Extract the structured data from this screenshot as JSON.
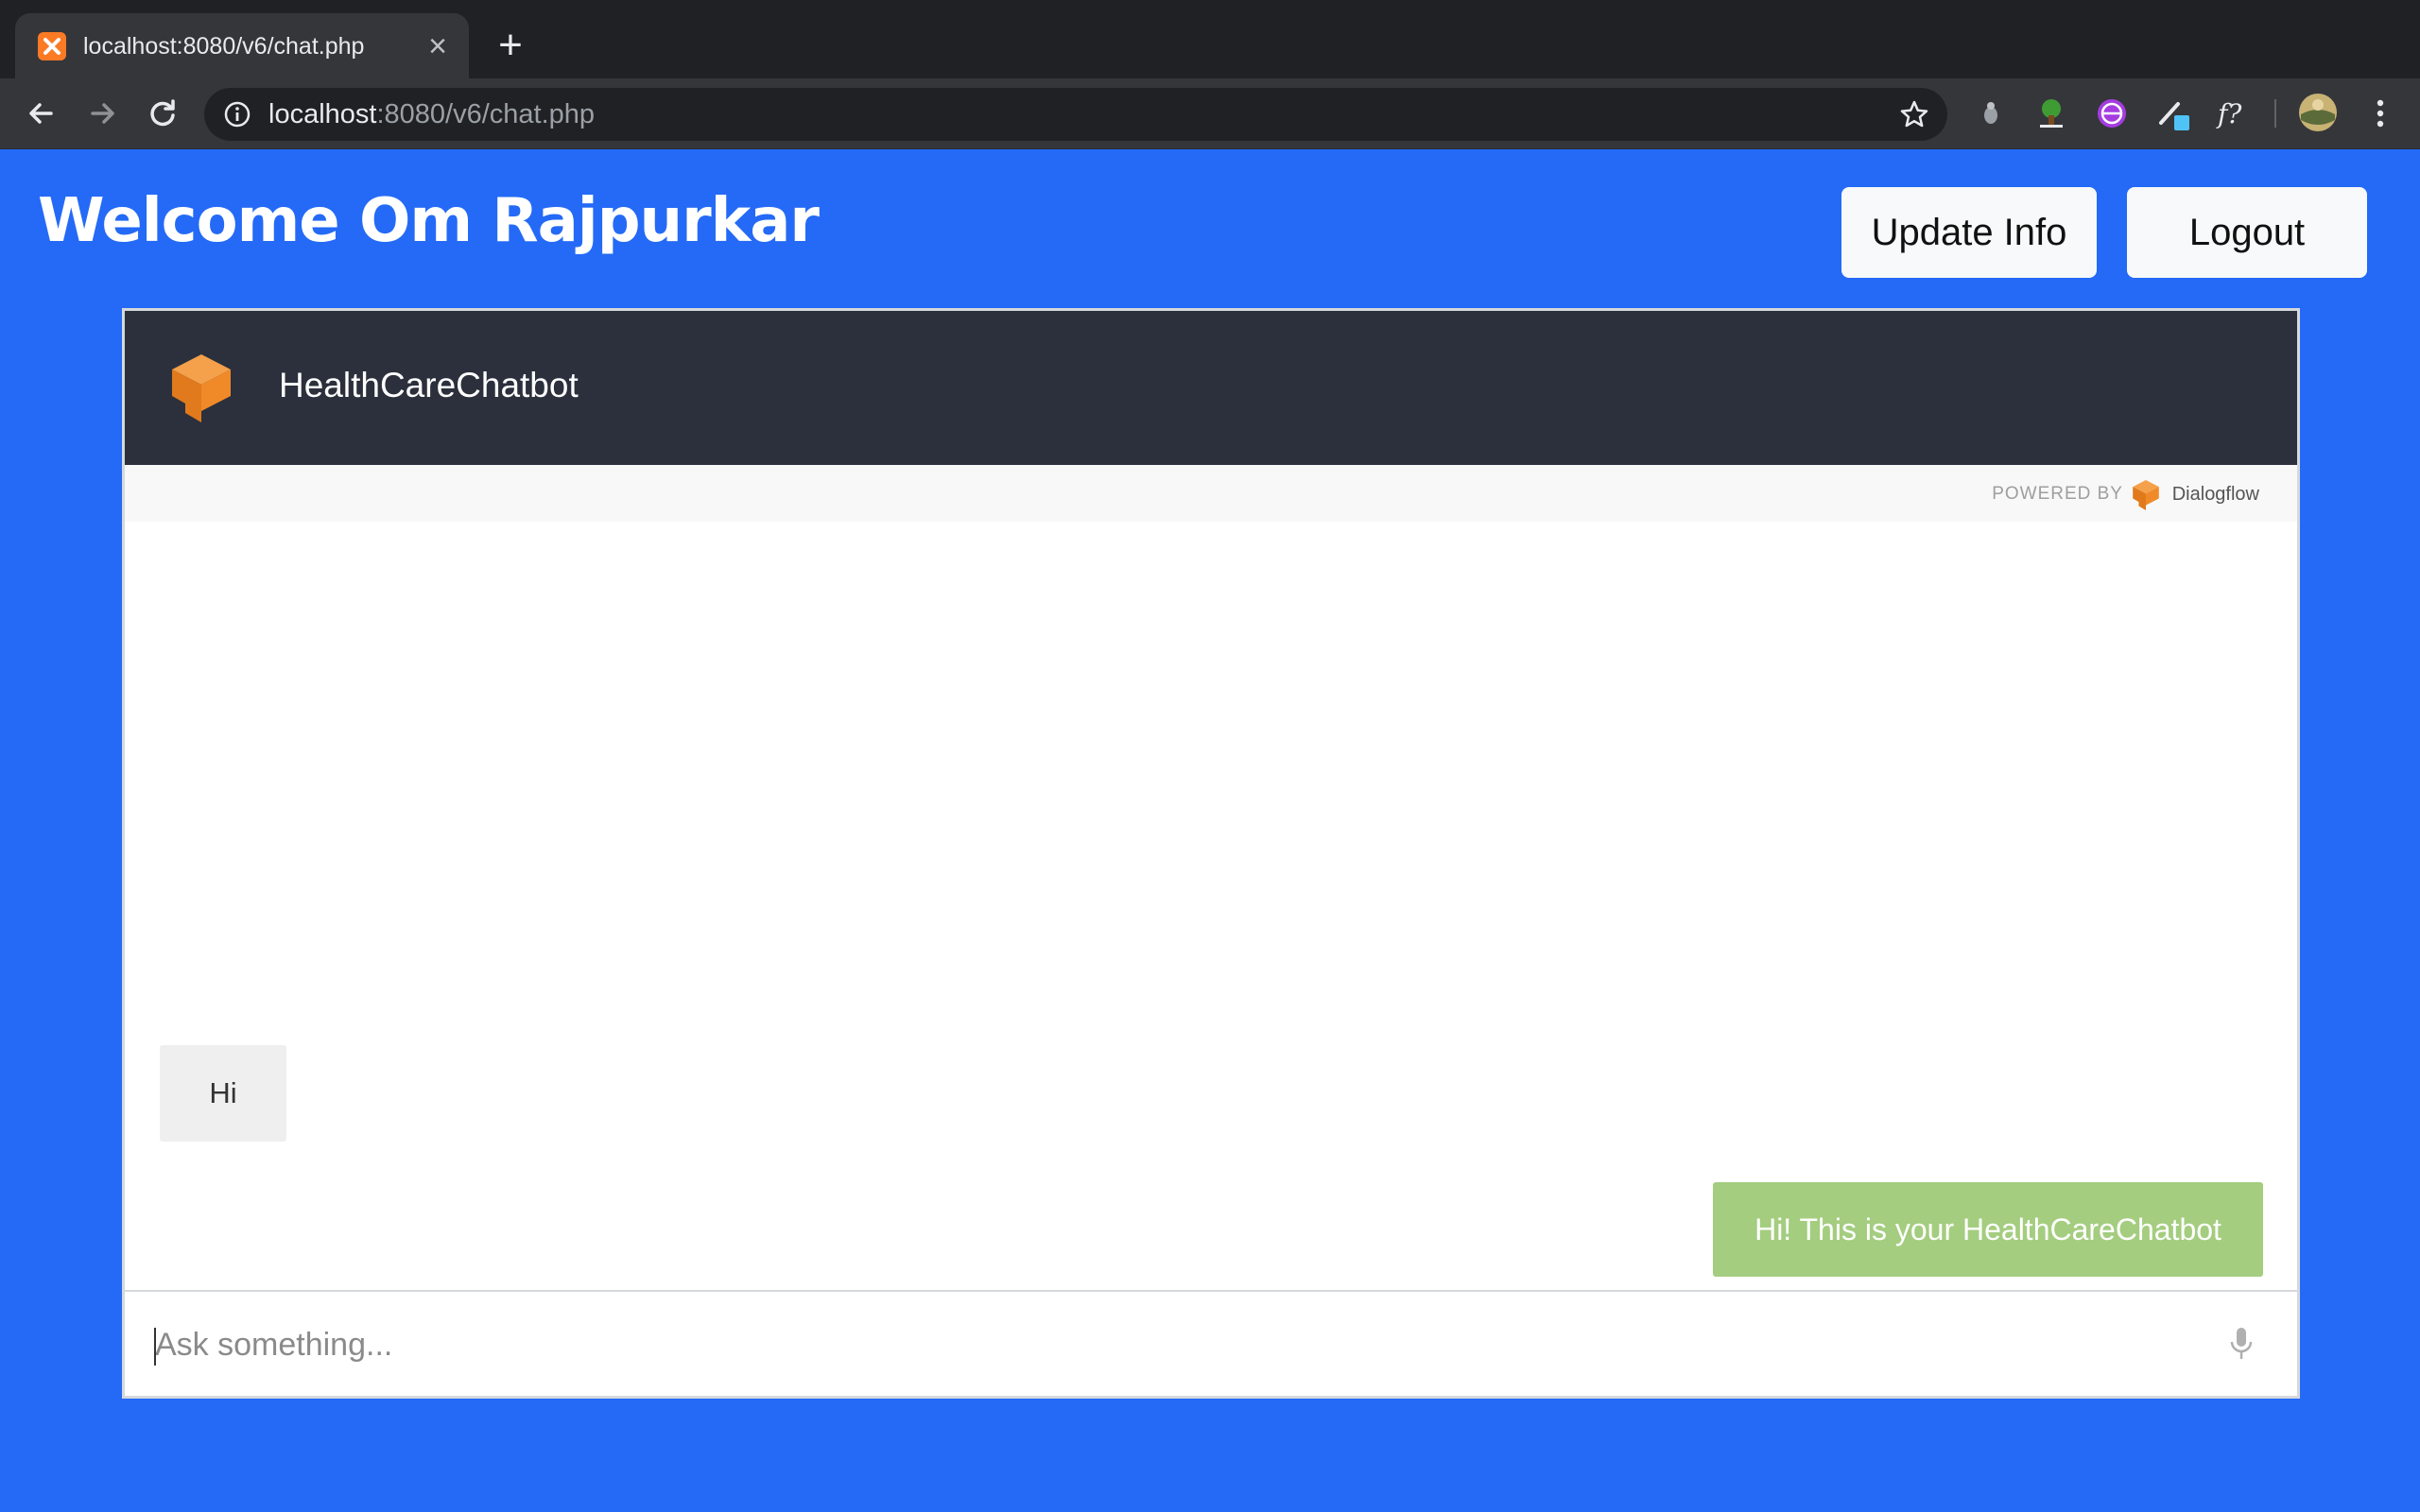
{
  "browser": {
    "tab_title": "localhost:8080/v6/chat.php",
    "url_host": "localhost",
    "url_rest": ":8080/v6/chat.php"
  },
  "page": {
    "welcome_text": "Welcome Om Rajpurkar",
    "update_info_label": "Update Info",
    "logout_label": "Logout"
  },
  "chat": {
    "bot_name": "HealthCareChatbot",
    "powered_by_label": "POWERED BY",
    "powered_by_brand": "Dialogflow",
    "messages": [
      {
        "from": "user",
        "text": "Hi"
      },
      {
        "from": "bot",
        "text": "Hi! This is your HealthCareChatbot"
      }
    ],
    "input_placeholder": "Ask something..."
  },
  "colors": {
    "page_background": "#246af6",
    "chat_header": "#2b303c",
    "bot_bubble": "#a4cd7f",
    "user_bubble": "#efefef",
    "dialogflow_orange": "#f5821f"
  },
  "icons": {
    "tab_favicon": "xampp-icon",
    "back": "arrow-left-icon",
    "forward": "arrow-right-icon",
    "reload": "reload-icon",
    "info": "info-icon",
    "bookmark": "star-icon",
    "menu": "kebab-menu-icon",
    "mic": "microphone-icon"
  }
}
